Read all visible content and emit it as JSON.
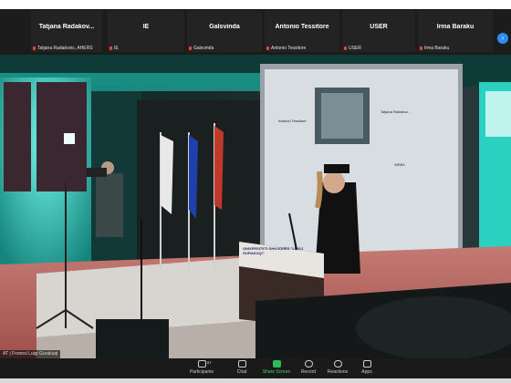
{
  "participants": [
    {
      "name": "Tatjana  Radakov...",
      "label": "Tatjana Radakovic, AHERS"
    },
    {
      "name": "IE",
      "label": "IE"
    },
    {
      "name": "Galsvinda",
      "label": "Galsvinda"
    },
    {
      "name": "Antonio Tessitore",
      "label": "Antonio Tessitore"
    },
    {
      "name": "USER",
      "label": "USER"
    },
    {
      "name": "Irma Baraku",
      "label": "Irma Baraku"
    }
  ],
  "stage": {
    "speaker_label": "AT | Fronesi Luigi Gurakuqi",
    "podium_text": "UNIVERSITETI SHKODRËS \"LUIGJ GURAKUQI\"",
    "screen_tile_name": "Antonio Tessitore",
    "screen_label_2": "Tatjana  Radakov...",
    "screen_label_3": "WEBX"
  },
  "toolbar": {
    "participants": "Participants",
    "participants_count": "57",
    "chat": "Chat",
    "share_screen": "Share Screen",
    "record": "Record",
    "reactions": "Reactions",
    "apps": "Apps"
  },
  "colors": {
    "share_green": "#2ebc59",
    "mic_muted_red": "#e5493a",
    "accent_blue": "#2d8cff"
  }
}
